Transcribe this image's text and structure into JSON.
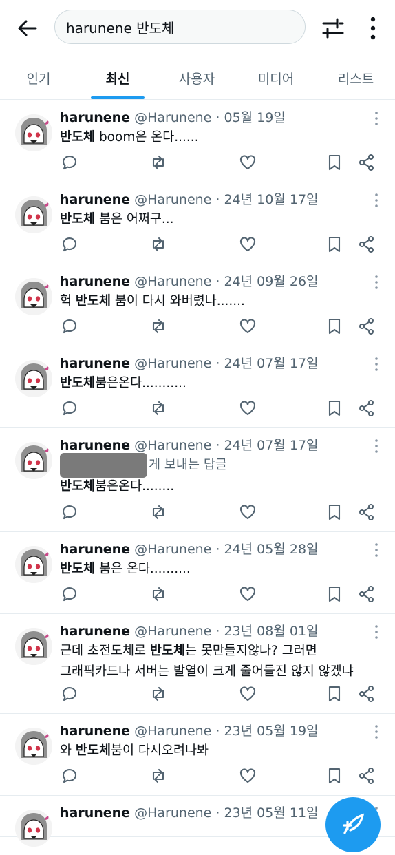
{
  "search": {
    "query": "harunene 반도체"
  },
  "tabs": [
    "인기",
    "최신",
    "사용자",
    "미디어",
    "리스트"
  ],
  "active_tab": "최신",
  "posts": [
    {
      "name": "harunene",
      "handle": "@Harunene · 05월 19일",
      "pre": "",
      "bold": "반도체",
      "post": " boom은 온다......"
    },
    {
      "name": "harunene",
      "handle": "@Harunene · 24년 10월 17일",
      "pre": "",
      "bold": "반도체",
      "post": " 붐은 어쩌구..."
    },
    {
      "name": "harunene",
      "handle": "@Harunene · 24년 09월 26일",
      "pre": "헉 ",
      "bold": "반도체",
      "post": " 붐이 다시 와버렸나......."
    },
    {
      "name": "harunene",
      "handle": "@Harunene · 24년 07월 17일",
      "pre": "",
      "bold": "반도체",
      "post": "붐은온다..........."
    },
    {
      "name": "harunene",
      "handle": "@Harunene · 24년 07월 17일",
      "reply_to": "게 보내는 답글",
      "pre": "",
      "bold": "반도체",
      "post": "붐은온다........"
    },
    {
      "name": "harunene",
      "handle": "@Harunene · 24년 05월 28일",
      "pre": "",
      "bold": "반도체",
      "post": " 붐은 온다.........."
    },
    {
      "name": "harunene",
      "handle": "@Harunene · 23년 08월 01일",
      "pre": "근데 초전도체로 ",
      "bold": "반도체",
      "post": "는 못만들지않나?  그러면",
      "line2": "그래픽카드나 서버는 발열이 크게 줄어들진 않지 않겠냐"
    },
    {
      "name": "harunene",
      "handle": "@Harunene · 23년 05월 19일",
      "pre": "와 ",
      "bold": "반도체",
      "post": "붐이 다시오려나봐"
    },
    {
      "name": "harunene",
      "handle": "@Harunene · 23년 05월 11일",
      "pre": "",
      "bold": "",
      "post": ""
    }
  ],
  "icons": {
    "back": "arrow-left-icon",
    "filter": "filter-sliders-icon",
    "more": "more-vertical-icon",
    "reply": "reply-icon",
    "retweet": "retweet-icon",
    "like": "heart-icon",
    "bookmark": "bookmark-icon",
    "share": "share-icon",
    "compose": "compose-icon"
  },
  "colors": {
    "accent": "#1d9bf0",
    "text": "#0f1419",
    "muted": "#536471"
  }
}
